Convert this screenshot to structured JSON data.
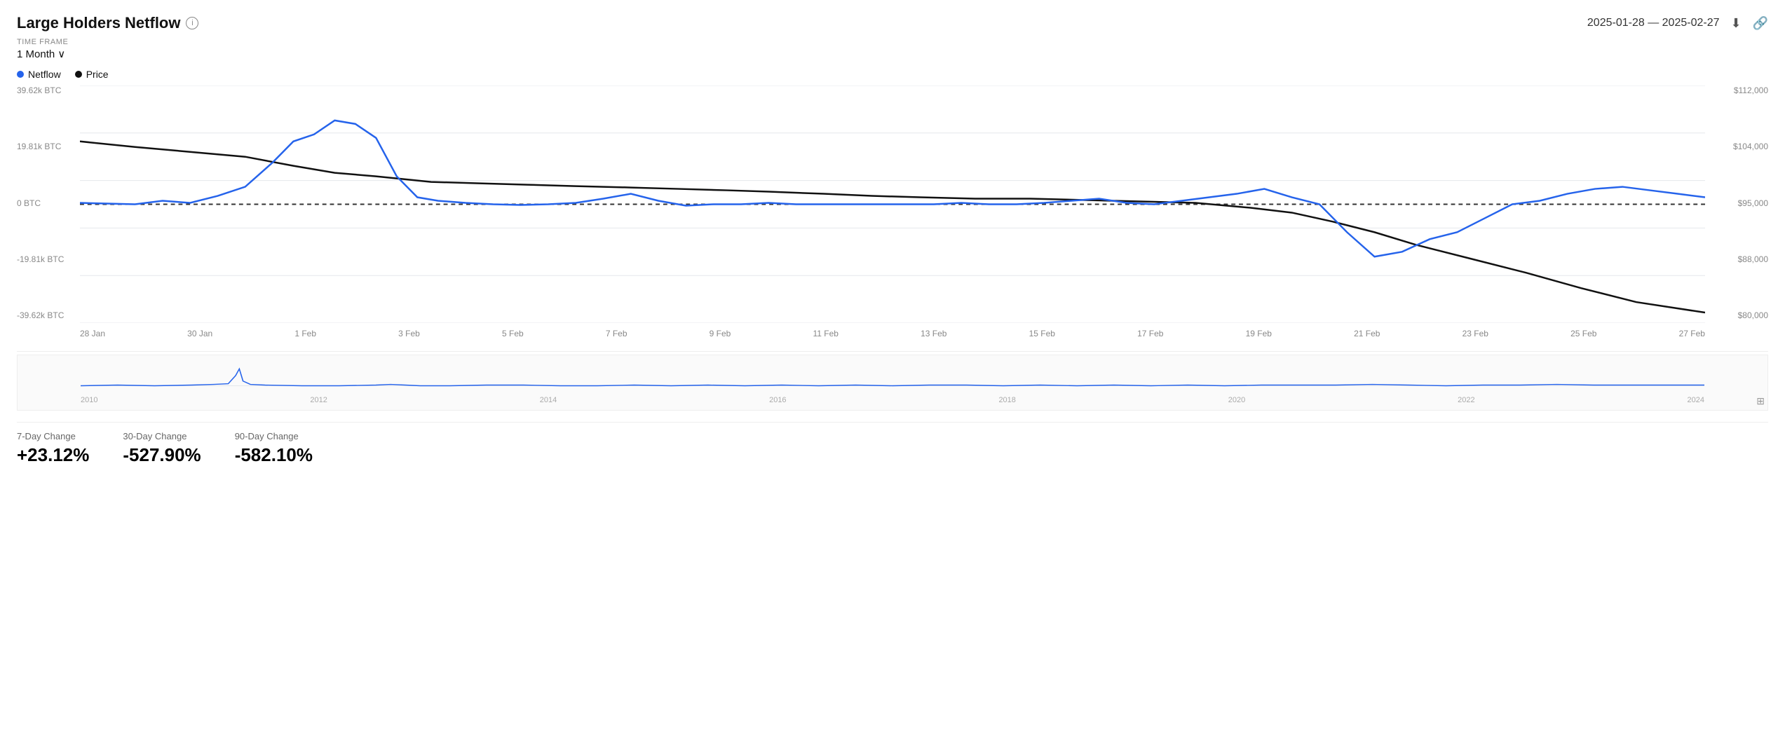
{
  "header": {
    "title": "Large Holders Netflow",
    "date_range": "2025-01-28 — 2025-02-27",
    "info_icon": "ⓘ",
    "download_icon": "⬇",
    "link_icon": "🔗"
  },
  "timeframe": {
    "label": "TIME FRAME",
    "value": "1 Month",
    "chevron": "∨"
  },
  "legend": [
    {
      "label": "Netflow",
      "color": "#2563eb"
    },
    {
      "label": "Price",
      "color": "#111"
    }
  ],
  "y_axis_left": [
    "39.62k BTC",
    "19.81k BTC",
    "0 BTC",
    "-19.81k BTC",
    "-39.62k BTC"
  ],
  "y_axis_right": [
    "$112,000",
    "$104,000",
    "$95,000",
    "$88,000",
    "$80,000"
  ],
  "x_axis": [
    "28 Jan",
    "30 Jan",
    "1 Feb",
    "3 Feb",
    "5 Feb",
    "7 Feb",
    "9 Feb",
    "11 Feb",
    "13 Feb",
    "15 Feb",
    "17 Feb",
    "19 Feb",
    "21 Feb",
    "23 Feb",
    "25 Feb",
    "27 Feb"
  ],
  "mini_x_axis": [
    "2010",
    "2012",
    "2014",
    "2016",
    "2018",
    "2020",
    "2022",
    "2024"
  ],
  "stats": [
    {
      "label": "7-Day Change",
      "value": "+23.12%",
      "positive": true
    },
    {
      "label": "30-Day Change",
      "value": "-527.90%",
      "positive": false
    },
    {
      "label": "90-Day Change",
      "value": "-582.10%",
      "positive": false
    }
  ],
  "colors": {
    "netflow": "#2563eb",
    "price": "#111111",
    "grid": "#e5e7eb",
    "zero_line": "#555"
  }
}
